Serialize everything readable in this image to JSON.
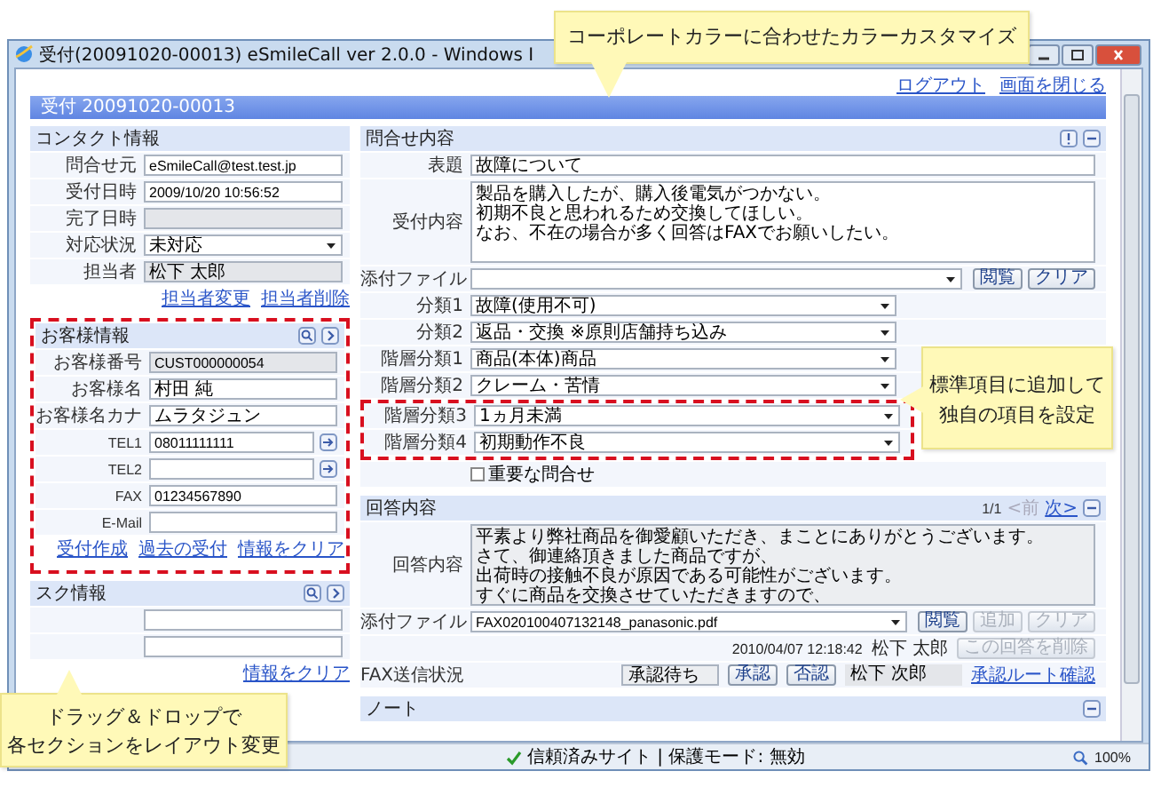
{
  "window": {
    "title": "受付(20091020-00013) eSmileCall ver 2.0.0 - Windows I"
  },
  "header_links": [
    "ログアウト",
    "画面を閉じる"
  ],
  "heading": "受付 20091020-00013",
  "contact": {
    "title": "コンタクト情報",
    "fields": [
      {
        "label": "問合せ元",
        "kind": "text",
        "value": "eSmileCall@test.test.jp"
      },
      {
        "label": "受付日時",
        "kind": "text",
        "value": "2009/10/20 10:56:52"
      },
      {
        "label": "完了日時",
        "kind": "readonly"
      },
      {
        "label": "対応状況",
        "kind": "select",
        "value": "未対応"
      },
      {
        "label": "担当者",
        "kind": "readonly",
        "value": "松下 太郎"
      }
    ],
    "links": [
      "担当者変更",
      "担当者削除"
    ]
  },
  "customer": {
    "title": "お客様情報",
    "highlighted": true,
    "fields": [
      {
        "label": "お客様番号",
        "kind": "readonly",
        "value": "CUST000000054"
      },
      {
        "label": "お客様名",
        "kind": "text",
        "value": "村田 純"
      },
      {
        "label": "お客様名カナ",
        "kind": "text",
        "value": "ムラタジュン"
      },
      {
        "label": "TEL1",
        "kind": "phone",
        "value": "08011111111"
      },
      {
        "label": "TEL2",
        "kind": "phone"
      },
      {
        "label": "FAX",
        "kind": "text",
        "value": "01234567890"
      },
      {
        "label": "E-Mail",
        "kind": "text"
      }
    ],
    "links": [
      "受付作成",
      "過去の受付",
      "情報をクリア"
    ]
  },
  "task": {
    "title": "スク情報",
    "fields": [
      {
        "kind": "text"
      },
      {
        "kind": "text"
      }
    ],
    "links": [
      "情報をクリア"
    ]
  },
  "inquiry": {
    "title": "問合せ内容",
    "subject": {
      "label": "表題",
      "value": "故障について"
    },
    "body": {
      "label": "受付内容",
      "lines": [
        "製品を購入したが、購入後電気がつかない。",
        "初期不良と思われるため交換してほしい。",
        "なお、不在の場合が多く回答はFAXでお願いしたい。"
      ]
    },
    "attachment": {
      "label": "添付ファイル",
      "buttons": [
        {
          "label": "閲覧",
          "disabled": false
        },
        {
          "label": "クリア",
          "disabled": false
        }
      ]
    },
    "classifications": [
      {
        "label": "分類1",
        "value": "故障(使用不可)",
        "highlighted": false
      },
      {
        "label": "分類2",
        "value": "返品・交換 ※原則店舗持ち込み",
        "highlighted": false
      },
      {
        "label": "階層分類1",
        "value": "商品(本体)商品",
        "highlighted": false
      },
      {
        "label": "階層分類2",
        "value": "クレーム・苦情",
        "highlighted": false
      },
      {
        "label": "階層分類3",
        "value": "1ヵ月未満",
        "highlighted": true
      },
      {
        "label": "階層分類4",
        "value": "初期動作不良",
        "highlighted": true
      }
    ],
    "important": {
      "label": "重要な問合せ",
      "checked": false
    }
  },
  "answer": {
    "title": "回答内容",
    "page": "1/1",
    "prev": "<前",
    "next": "次>",
    "body": {
      "label": "回答内容",
      "lines": [
        "平素より弊社商品を御愛顧いただき、まことにありがとうございます。",
        "さて、御連絡頂きました商品ですが、",
        "出荷時の接触不良が原因である可能性がございます。",
        "すぐに商品を交換させていただきますので、"
      ]
    },
    "attachment": {
      "label": "添付ファイル",
      "value": "FAX020100407132148_panasonic.pdf",
      "buttons": [
        {
          "label": "閲覧",
          "disabled": false
        },
        {
          "label": "追加",
          "disabled": true
        },
        {
          "label": "クリア",
          "disabled": true
        }
      ]
    },
    "meta": {
      "date": "2010/04/07 12:18:42",
      "author": "松下 太郎",
      "delete_button": {
        "label": "この回答を削除",
        "disabled": true
      }
    },
    "fax": {
      "label": "FAX送信状況",
      "status": "承認待ち",
      "buttons": [
        {
          "label": "承認",
          "disabled": false
        },
        {
          "label": "否認",
          "disabled": false
        }
      ],
      "approver": "松下 次郎",
      "link": "承認ルート確認"
    }
  },
  "note": {
    "title": "ノート"
  },
  "status_bar": {
    "zone": "信頼済みサイト | 保護モード: 無効",
    "zoom": "100%"
  },
  "callouts": [
    {
      "lines": [
        "コーポレートカラーに合わせたカラーカスタマイズ"
      ]
    },
    {
      "lines": [
        "標準項目に追加して",
        "独自の項目を設定"
      ]
    },
    {
      "lines": [
        "ドラッグ＆ドロップで",
        "各セクションをレイアウト変更"
      ]
    }
  ]
}
